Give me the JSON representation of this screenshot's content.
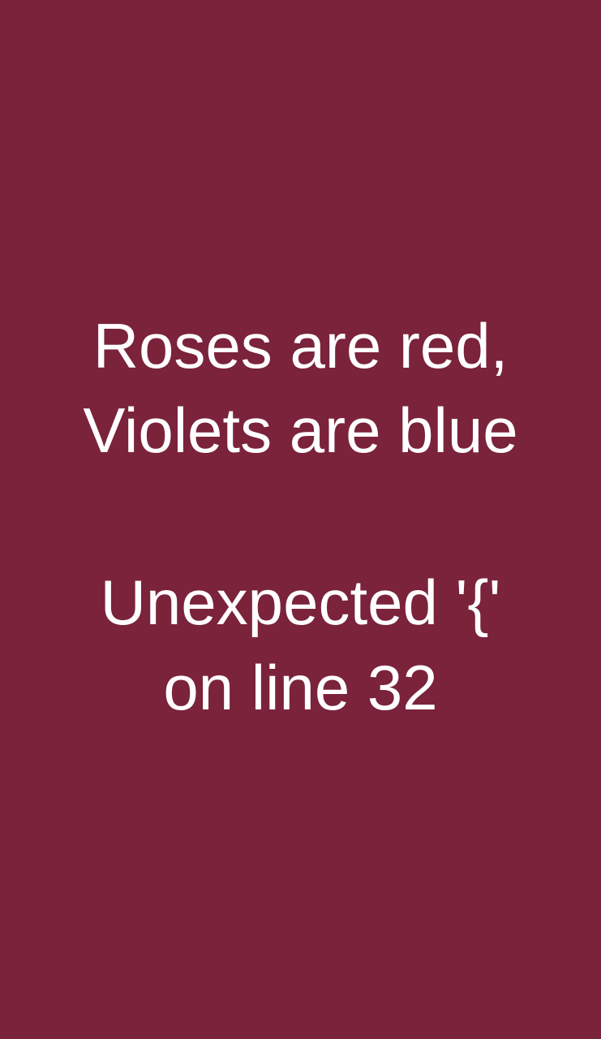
{
  "background_color": "#7a233a",
  "text_color": "#ffffff",
  "message": {
    "line1": "Roses are red,",
    "line2": "Violets are blue",
    "line3": "Unexpected '{'",
    "line4": "on line 32"
  }
}
